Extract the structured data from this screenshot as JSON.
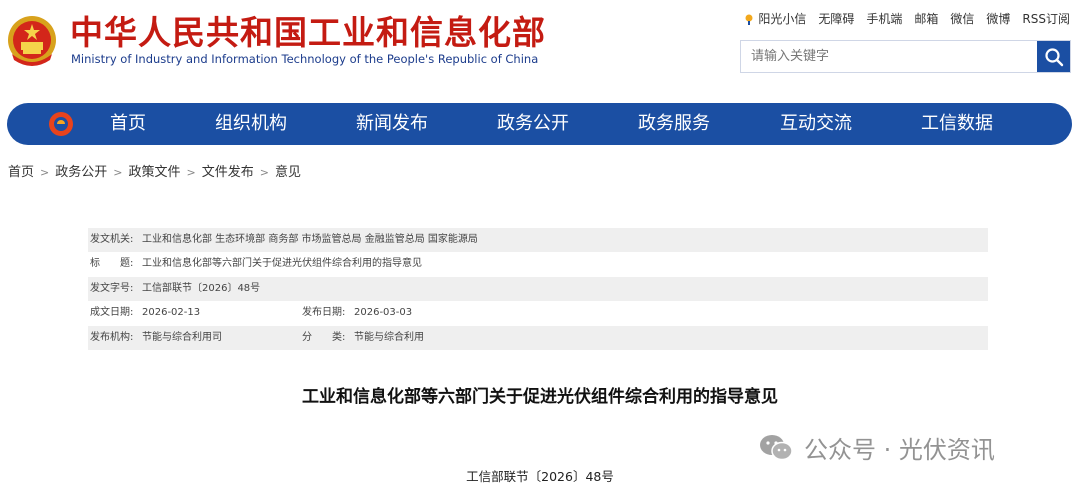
{
  "header": {
    "title": "中华人民共和国工业和信息化部",
    "subtitle": "Ministry of Industry and Information Technology of the People's Republic of China",
    "top_links": [
      "阳光小信",
      "无障碍",
      "手机端",
      "邮箱",
      "微信",
      "微博",
      "RSS订阅"
    ],
    "search": {
      "placeholder": "请输入关键字",
      "value": ""
    }
  },
  "nav": {
    "items": [
      "首页",
      "组织机构",
      "新闻发布",
      "政务公开",
      "政务服务",
      "互动交流",
      "工信数据"
    ]
  },
  "breadcrumb": [
    "首页",
    "政务公开",
    "政策文件",
    "文件发布",
    "意见"
  ],
  "info": {
    "issuer_label": "发文机关:",
    "issuer_value": "工业和信息化部 生态环境部 商务部 市场监管总局 金融监管总局 国家能源局",
    "title_label": "标　　题:",
    "title_value": "工业和信息化部等六部门关于促进光伏组件综合利用的指导意见",
    "docno_label": "发文字号:",
    "docno_value": "工信部联节〔2026〕48号",
    "created_label": "成文日期:",
    "created_value": "2026-02-13",
    "published_label": "发布日期:",
    "published_value": "2026-03-03",
    "org_label": "发布机构:",
    "org_value": "节能与综合利用司",
    "category_label": "分　　类:",
    "category_value": "节能与综合利用"
  },
  "document": {
    "title": "工业和信息化部等六部门关于促进光伏组件综合利用的指导意见",
    "number": "工信部联节〔2026〕48号"
  },
  "watermark": {
    "text": "公众号 · 光伏资讯"
  },
  "colors": {
    "brand_red": "#c41b12",
    "nav_blue": "#1b4fa3",
    "row_shade": "#efefef"
  }
}
